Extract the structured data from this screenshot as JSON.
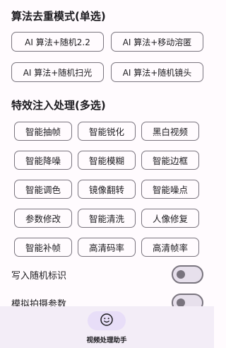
{
  "algorithm_section": {
    "title": "算法去重模式(单选)",
    "options": [
      {
        "label": "AI 算法+随机2.2"
      },
      {
        "label": "AI 算法+移动溶匿"
      },
      {
        "label": "AI 算法+随机扫光"
      },
      {
        "label": "AI 算法+随机镜头"
      }
    ]
  },
  "effects_section": {
    "title": "特效注入处理(多选)",
    "options": [
      {
        "label": "智能抽帧"
      },
      {
        "label": "智能锐化"
      },
      {
        "label": "黑白视频"
      },
      {
        "label": "智能降噪"
      },
      {
        "label": "智能模糊"
      },
      {
        "label": "智能边框"
      },
      {
        "label": "智能调色"
      },
      {
        "label": "镜像翻转"
      },
      {
        "label": "智能噪点"
      },
      {
        "label": "参数修改"
      },
      {
        "label": "智能清洗"
      },
      {
        "label": "人像修复"
      },
      {
        "label": "智能补帧"
      },
      {
        "label": "高清码率"
      },
      {
        "label": "高清帧率"
      }
    ]
  },
  "toggles": [
    {
      "label": "写入随机标识",
      "on": false
    },
    {
      "label": "模拟拍摄参数",
      "on": false
    }
  ],
  "bottom_nav": {
    "items": [
      {
        "label": "视频处理助手",
        "icon": "smiley-face-icon",
        "selected": true
      }
    ]
  },
  "colors": {
    "background": "#fffbfe",
    "outline": "#79747e",
    "nav_background": "#f3edf7",
    "nav_indicator": "#e8def8"
  }
}
